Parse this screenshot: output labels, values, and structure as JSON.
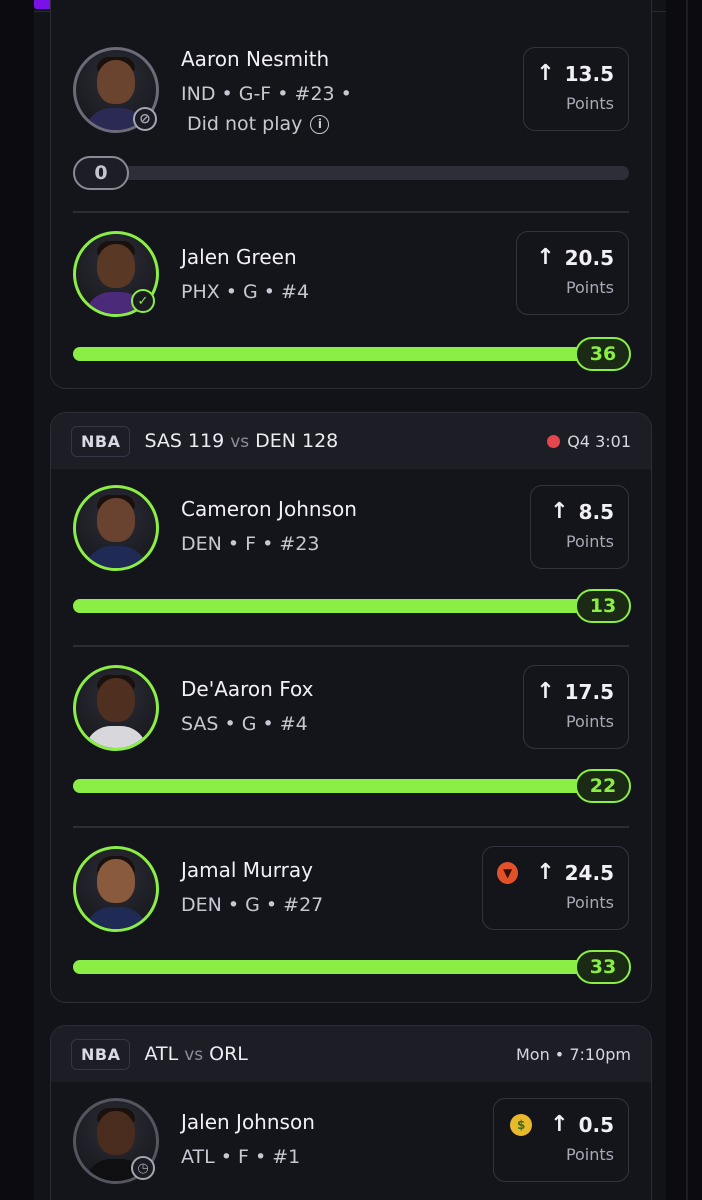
{
  "header": {
    "progress_fraction": 0.5
  },
  "card1": {
    "players": [
      {
        "name": "Aaron Nesmith",
        "meta": "IND • G-F • #23 •",
        "status_note": "Did not play",
        "line_value": "13.5",
        "line_unit": "Points",
        "actual": "0",
        "progress": 0,
        "avatar_state": "did-not-play"
      },
      {
        "name": "Jalen Green",
        "meta": "PHX • G • #4",
        "line_value": "20.5",
        "line_unit": "Points",
        "actual": "36",
        "progress": 1,
        "avatar_state": "hit"
      }
    ]
  },
  "card2": {
    "league": "NBA",
    "away_team": "SAS",
    "away_score": "119",
    "vs": "vs",
    "home_team": "DEN",
    "home_score": "128",
    "status": "Q4 3:01",
    "players": [
      {
        "name": "Cameron Johnson",
        "meta": "DEN • F • #23",
        "line_value": "8.5",
        "line_unit": "Points",
        "actual": "13",
        "progress": 1
      },
      {
        "name": "De'Aaron Fox",
        "meta": "SAS • G • #4",
        "line_value": "17.5",
        "line_unit": "Points",
        "actual": "22",
        "progress": 1
      },
      {
        "name": "Jamal Murray",
        "meta": "DEN • G • #27",
        "line_value": "24.5",
        "line_unit": "Points",
        "actual": "33",
        "progress": 1,
        "tag_emoji": "devil-icon"
      }
    ]
  },
  "card3": {
    "league": "NBA",
    "away_team": "ATL",
    "vs": "vs",
    "home_team": "ORL",
    "status": "Mon • 7:10pm",
    "players": [
      {
        "name": "Jalen Johnson",
        "meta": "ATL • F • #1",
        "line_value": "0.5",
        "line_unit": "Points",
        "tag_emoji": "money-mouth-icon",
        "avatar_state": "scheduled"
      }
    ]
  },
  "colors": {
    "accent_green": "#8aee44",
    "accent_purple": "#7a12e8",
    "live_red": "#e5454d",
    "background": "#121219"
  }
}
